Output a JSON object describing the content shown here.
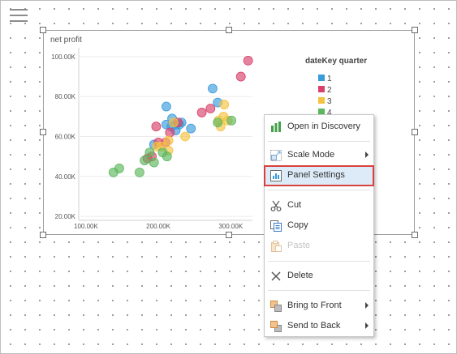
{
  "colors": {
    "q1": "#3a9bdc",
    "q2": "#d9416b",
    "q3": "#f5c342",
    "q4": "#5cb85c",
    "highlight_border": "#d9413b",
    "highlight_bg": "#dcebf7"
  },
  "panel": {
    "title": "net profit"
  },
  "chart_data": {
    "type": "scatter",
    "title": "",
    "xlabel": "",
    "ylabel": "net profit",
    "xlim": [
      90000,
      330000
    ],
    "ylim": [
      18000,
      102000
    ],
    "x_ticks": [
      "100.00K",
      "200.00K",
      "300.00K"
    ],
    "y_ticks": [
      "100.00K",
      "80.00K",
      "60.00K",
      "40.00K",
      "20.00K"
    ],
    "grid": true,
    "legend_position": "right",
    "legend_title": "dateKey quarter",
    "series": [
      {
        "name": "1",
        "color": "#3a9bdc",
        "points": [
          [
            211000,
            75000
          ],
          [
            219000,
            69000
          ],
          [
            224000,
            66000
          ],
          [
            232000,
            67000
          ],
          [
            218000,
            65000
          ],
          [
            211000,
            66000
          ],
          [
            224000,
            63000
          ],
          [
            229000,
            66000
          ],
          [
            245000,
            64000
          ],
          [
            275000,
            84000
          ],
          [
            282000,
            77000
          ],
          [
            194000,
            56000
          ]
        ]
      },
      {
        "name": "2",
        "color": "#d9416b",
        "points": [
          [
            324000,
            98000
          ],
          [
            314000,
            90000
          ],
          [
            260000,
            72000
          ],
          [
            272000,
            74000
          ],
          [
            197000,
            65000
          ],
          [
            210000,
            57000
          ],
          [
            200000,
            57000
          ],
          [
            191000,
            50000
          ],
          [
            185000,
            49000
          ],
          [
            216000,
            62000
          ],
          [
            227000,
            67000
          ]
        ]
      },
      {
        "name": "3",
        "color": "#f5c342",
        "points": [
          [
            291000,
            76000
          ],
          [
            290000,
            70000
          ],
          [
            283000,
            68000
          ],
          [
            237000,
            60000
          ],
          [
            214000,
            58000
          ],
          [
            198000,
            55000
          ],
          [
            204000,
            55000
          ],
          [
            214000,
            53000
          ],
          [
            286000,
            65000
          ],
          [
            296000,
            68000
          ],
          [
            221000,
            67000
          ]
        ]
      },
      {
        "name": "4",
        "color": "#5cb85c",
        "points": [
          [
            138000,
            42000
          ],
          [
            146000,
            44000
          ],
          [
            174000,
            42000
          ],
          [
            194000,
            47000
          ],
          [
            188000,
            52000
          ],
          [
            206000,
            52000
          ],
          [
            212000,
            50000
          ],
          [
            282000,
            67000
          ],
          [
            301000,
            68000
          ],
          [
            181000,
            48000
          ]
        ]
      }
    ]
  },
  "legend": {
    "title": "dateKey quarter",
    "items": [
      {
        "label": "1"
      },
      {
        "label": "2"
      },
      {
        "label": "3"
      },
      {
        "label": "4"
      }
    ]
  },
  "context_menu": {
    "items": [
      {
        "label": "Open in Discovery",
        "icon": "bar-chart-icon",
        "enabled": true,
        "submenu": false
      },
      {
        "label": "Scale Mode",
        "icon": "scale-icon",
        "enabled": true,
        "submenu": true
      },
      {
        "label": "Panel Settings",
        "icon": "panel-settings-icon",
        "enabled": true,
        "submenu": false,
        "highlighted": true
      },
      {
        "label": "Cut",
        "icon": "scissors-icon",
        "enabled": true,
        "submenu": false
      },
      {
        "label": "Copy",
        "icon": "copy-icon",
        "enabled": true,
        "submenu": false
      },
      {
        "label": "Paste",
        "icon": "paste-icon",
        "enabled": false,
        "submenu": false
      },
      {
        "label": "Delete",
        "icon": "delete-icon",
        "enabled": true,
        "submenu": false
      },
      {
        "label": "Bring to Front",
        "icon": "bring-front-icon",
        "enabled": true,
        "submenu": true
      },
      {
        "label": "Send to Back",
        "icon": "send-back-icon",
        "enabled": true,
        "submenu": true
      }
    ]
  }
}
